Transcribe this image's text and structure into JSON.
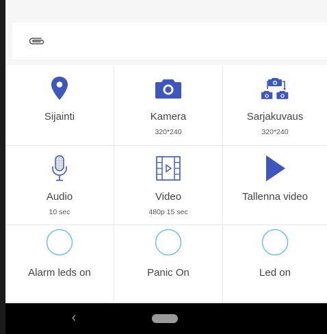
{
  "colors": {
    "accent": "#3d56c0",
    "ring": "#6cc3e6",
    "label": "#444444",
    "navbar": "#000000"
  },
  "attachment": {
    "icon": "paperclip-icon"
  },
  "tiles": [
    {
      "icon": "location-pin-icon",
      "label": "Sijainti",
      "sub": ""
    },
    {
      "icon": "camera-icon",
      "label": "Kamera",
      "sub": "320*240"
    },
    {
      "icon": "burst-camera-icon",
      "label": "Sarjakuvaus",
      "sub": "320*240"
    },
    {
      "icon": "microphone-icon",
      "label": "Audio",
      "sub": "10 sec"
    },
    {
      "icon": "video-film-icon",
      "label": "Video",
      "sub": "480p 15 sec"
    },
    {
      "icon": "play-icon",
      "label": "Tallenna video",
      "sub": ""
    },
    {
      "icon": "circle-toggle-icon",
      "label": "Alarm leds on",
      "sub": ""
    },
    {
      "icon": "circle-toggle-icon",
      "label": "Panic On",
      "sub": ""
    },
    {
      "icon": "circle-toggle-icon",
      "label": "Led on",
      "sub": ""
    }
  ],
  "navbar": {
    "back_glyph": "‹",
    "back_icon": "back-chevron-icon",
    "home_icon": "home-pill-icon"
  }
}
